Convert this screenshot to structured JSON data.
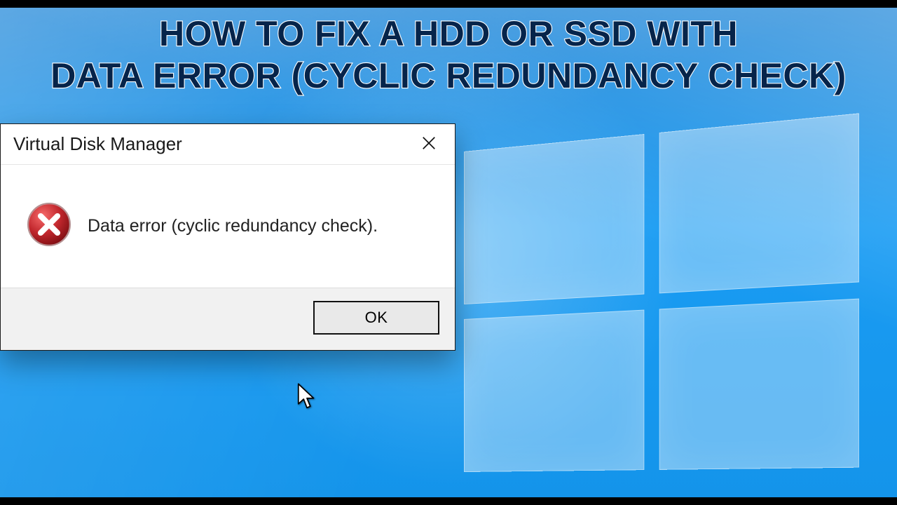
{
  "heading": {
    "line1": "HOW TO FIX A HDD OR SSD WITH",
    "line2": "DATA ERROR (CYCLIC REDUNDANCY CHECK)"
  },
  "dialog": {
    "title": "Virtual Disk Manager",
    "icon": "error-circle-icon",
    "message": "Data error (cyclic redundancy check).",
    "ok_label": "OK",
    "close_label": "Close"
  },
  "colors": {
    "bg_primary": "#1494ea",
    "error_red": "#c1272d",
    "heading_fill": "#06244a"
  }
}
